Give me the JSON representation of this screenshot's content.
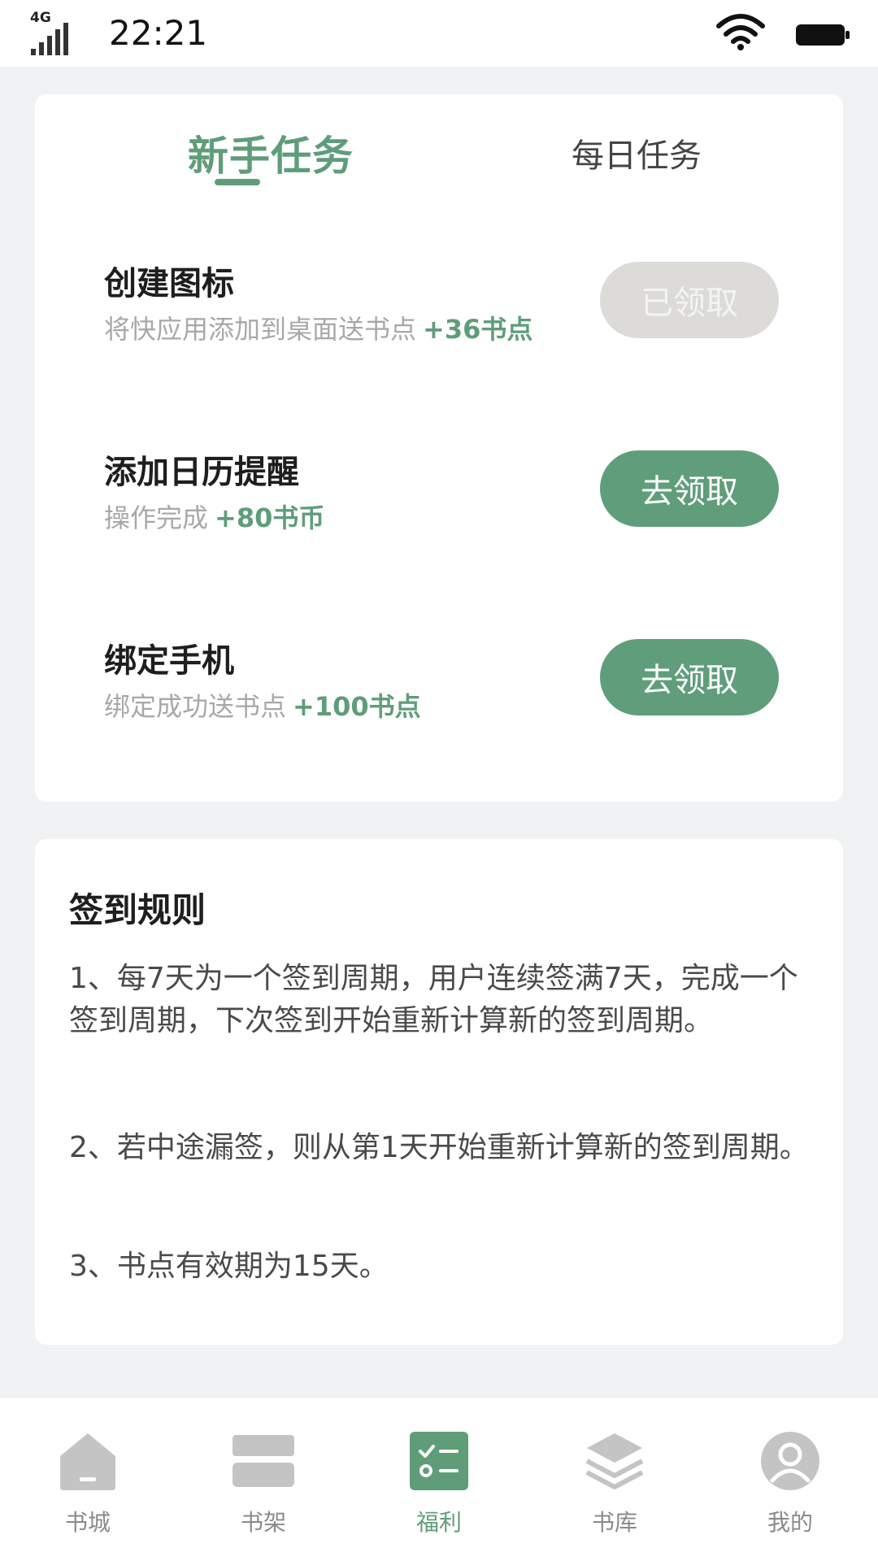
{
  "status_bar": {
    "network": "4G",
    "time": "22:21"
  },
  "tabs": {
    "newbie": "新手任务",
    "daily": "每日任务"
  },
  "tasks": [
    {
      "title": "创建图标",
      "desc": "将快应用添加到桌面送书点",
      "reward": "+36书点",
      "button": "已领取",
      "status": "claimed"
    },
    {
      "title": "添加日历提醒",
      "desc": "操作完成",
      "reward": "+80书币",
      "button": "去领取",
      "status": "available"
    },
    {
      "title": "绑定手机",
      "desc": "绑定成功送书点",
      "reward": "+100书点",
      "button": "去领取",
      "status": "available"
    }
  ],
  "rules": {
    "title": "签到规则",
    "items": [
      "1、每7天为一个签到周期，用户连续签满7天，完成一个签到周期，下次签到开始重新计算新的签到周期。",
      "2、若中途漏签，则从第1天开始重新计算新的签到周期。",
      "3、书点有效期为15天。"
    ]
  },
  "nav": [
    {
      "label": "书城",
      "icon": "home-icon"
    },
    {
      "label": "书架",
      "icon": "bookshelf-icon"
    },
    {
      "label": "福利",
      "icon": "welfare-icon"
    },
    {
      "label": "书库",
      "icon": "library-icon"
    },
    {
      "label": "我的",
      "icon": "profile-icon"
    }
  ],
  "active_nav": "福利",
  "colors": {
    "accent": "#5f9d79",
    "button_green": "#609e7b",
    "button_disabled": "#dcdbd8",
    "background": "#f1f2f4",
    "muted_text": "#a8a8a8",
    "nav_inactive": "#c4c4c4"
  }
}
